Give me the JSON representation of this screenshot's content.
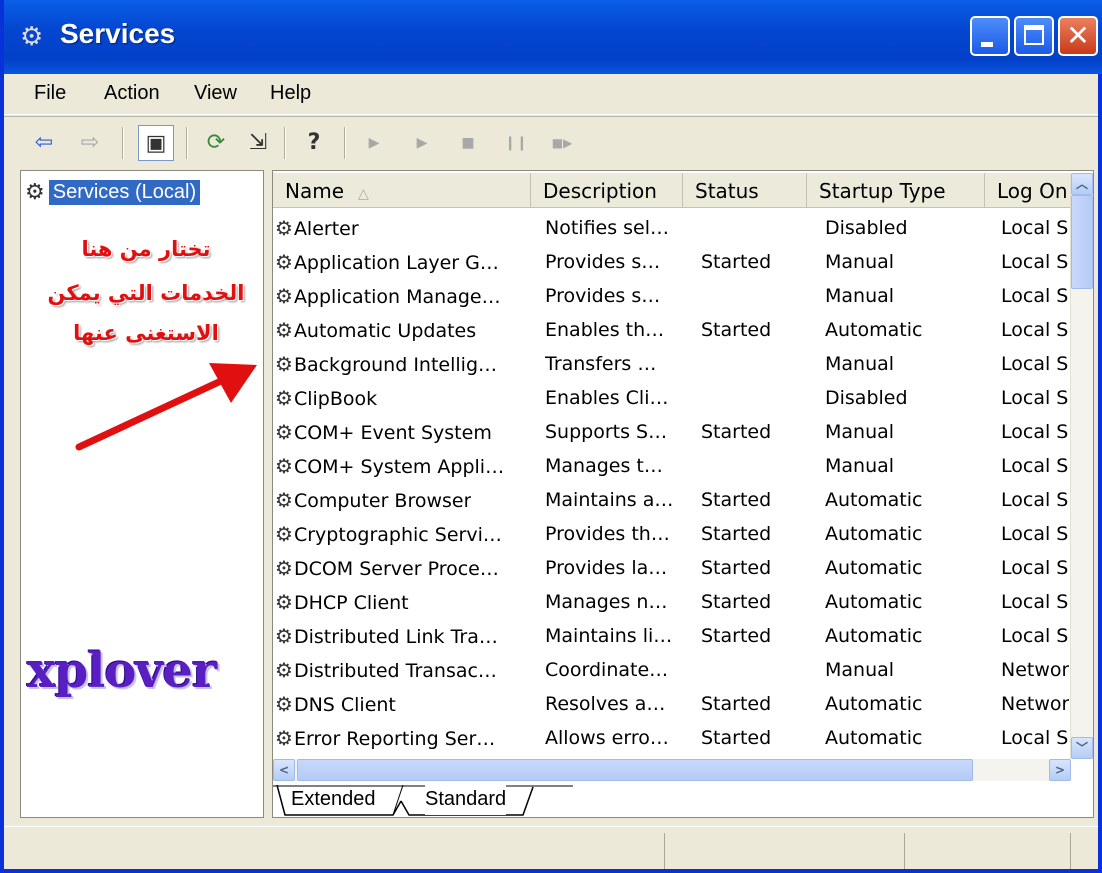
{
  "window": {
    "title": "Services",
    "title_icon": "services-gear-icon"
  },
  "menu": {
    "items": [
      "File",
      "Action",
      "View",
      "Help"
    ]
  },
  "toolbar": {
    "buttons": [
      {
        "name": "back-icon",
        "glyph": "⇦"
      },
      {
        "name": "forward-icon",
        "glyph": "⇨"
      },
      {
        "name": "show-hide-console-tree-icon",
        "glyph": "▣"
      },
      {
        "name": "refresh-icon",
        "glyph": "⟳"
      },
      {
        "name": "export-list-icon",
        "glyph": "⇲"
      },
      {
        "name": "help-icon",
        "glyph": "?"
      },
      {
        "name": "start-service-icon",
        "glyph": "▶"
      },
      {
        "name": "start-service-alt-icon",
        "glyph": "▶"
      },
      {
        "name": "stop-service-icon",
        "glyph": "■"
      },
      {
        "name": "pause-service-icon",
        "glyph": "❙❙"
      },
      {
        "name": "restart-service-icon",
        "glyph": "■▶"
      }
    ]
  },
  "tree": {
    "root_label": "Services (Local)"
  },
  "annotation": {
    "lines": [
      "تختار من هنا",
      "الخدمات التي يمكن",
      "الاستغنى عنها"
    ],
    "color": "#e01010"
  },
  "watermark": {
    "text": "xplover",
    "color": "#5a1fc2"
  },
  "list": {
    "columns": [
      "Name",
      "Description",
      "Status",
      "Startup Type",
      "Log On"
    ],
    "rows": [
      [
        "Alerter",
        "Notifies sel…",
        "",
        "Disabled",
        "Local S"
      ],
      [
        "Application Layer G…",
        "Provides s…",
        "Started",
        "Manual",
        "Local S"
      ],
      [
        "Application Manage…",
        "Provides s…",
        "",
        "Manual",
        "Local S"
      ],
      [
        "Automatic Updates",
        "Enables th…",
        "Started",
        "Automatic",
        "Local S"
      ],
      [
        "Background Intellig…",
        "Transfers …",
        "",
        "Manual",
        "Local S"
      ],
      [
        "ClipBook",
        "Enables Cli…",
        "",
        "Disabled",
        "Local S"
      ],
      [
        "COM+ Event System",
        "Supports S…",
        "Started",
        "Manual",
        "Local S"
      ],
      [
        "COM+ System Appli…",
        "Manages t…",
        "",
        "Manual",
        "Local S"
      ],
      [
        "Computer Browser",
        "Maintains a…",
        "Started",
        "Automatic",
        "Local S"
      ],
      [
        "Cryptographic Servi…",
        "Provides th…",
        "Started",
        "Automatic",
        "Local S"
      ],
      [
        "DCOM Server Proce…",
        "Provides la…",
        "Started",
        "Automatic",
        "Local S"
      ],
      [
        "DHCP Client",
        "Manages n…",
        "Started",
        "Automatic",
        "Local S"
      ],
      [
        "Distributed Link Tra…",
        "Maintains li…",
        "Started",
        "Automatic",
        "Local S"
      ],
      [
        "Distributed Transac…",
        "Coordinate…",
        "",
        "Manual",
        "Networ"
      ],
      [
        "DNS Client",
        "Resolves a…",
        "Started",
        "Automatic",
        "Networ"
      ],
      [
        "Error Reporting Ser…",
        "Allows erro…",
        "Started",
        "Automatic",
        "Local S"
      ]
    ]
  },
  "tabs": {
    "extended": "Extended",
    "standard": "Standard",
    "selected": "Standard"
  },
  "colors": {
    "titlebar": "#0446d0",
    "selection": "#316ac5",
    "chrome": "#ece9d8"
  }
}
